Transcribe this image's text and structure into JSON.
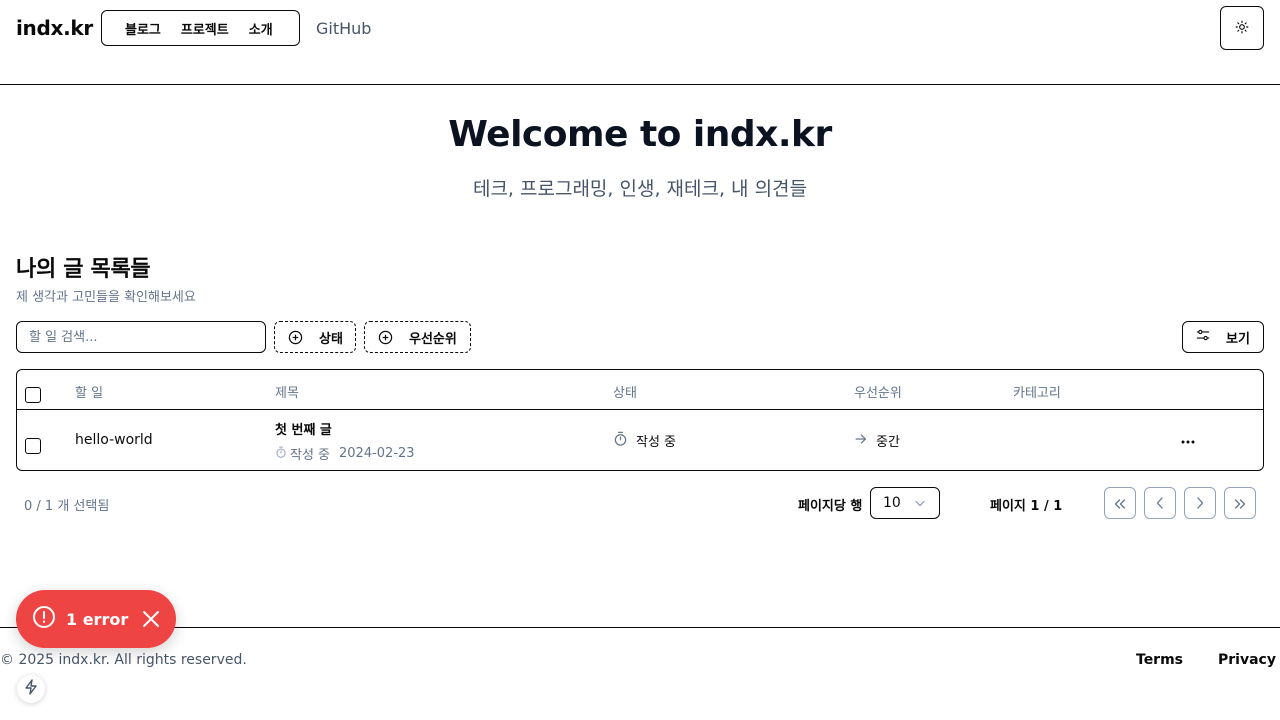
{
  "header": {
    "logo": "indx.kr",
    "nav": [
      {
        "label": "블로그"
      },
      {
        "label": "프로젝트"
      },
      {
        "label": "소개"
      }
    ],
    "github_label": "GitHub",
    "theme_icon": "sun-icon"
  },
  "hero": {
    "title": "Welcome to indx.kr",
    "subtitle": "테크, 프로그래밍, 인생, 재테크, 내 의견들"
  },
  "section": {
    "title": "나의 글 목록들",
    "description": "제 생각과 고민들을 확인해보세요"
  },
  "toolbar": {
    "search_placeholder": "할 일 검색...",
    "filter_status_label": "상태",
    "filter_priority_label": "우선순위",
    "view_label": "보기"
  },
  "table": {
    "columns": [
      "할 일",
      "제목",
      "상태",
      "우선순위",
      "카테고리"
    ],
    "rows": [
      {
        "task": "hello-world",
        "title": "첫 번째 글",
        "sub_status": "작성 중",
        "date": "2024-02-23",
        "status": "작성 중",
        "priority": "중간",
        "category": ""
      }
    ]
  },
  "pagination": {
    "selected_text": "0 / 1 개 선택됨",
    "rows_per_page_label": "페이지당 행",
    "rows_per_page_value": "10",
    "page_text": "페이지 1 / 1"
  },
  "error_toast": {
    "text": "1 error",
    "color": "#ef4444"
  },
  "footer": {
    "copyright": "© 2025 indx.kr. All rights reserved.",
    "terms": "Terms",
    "privacy": "Privacy"
  }
}
